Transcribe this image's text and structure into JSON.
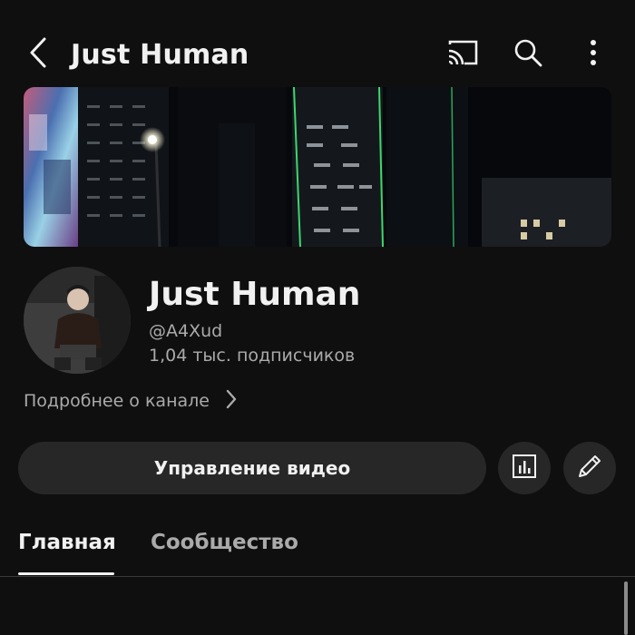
{
  "header": {
    "title": "Just Human",
    "icons": [
      "back-arrow-icon",
      "cast-icon",
      "search-icon",
      "more-vert-icon"
    ]
  },
  "banner": {
    "description_icon": "banner-image"
  },
  "channel": {
    "name": "Just Human",
    "handle": "@A4Xud",
    "subscribers": "1,04 тыс. подписчиков",
    "more_label": "Подробнее о канале"
  },
  "actions": {
    "manage_label": "Управление видео",
    "analytics_icon": "analytics-icon",
    "edit_icon": "pencil-icon"
  },
  "tabs": [
    {
      "label": "Главная",
      "active": true
    },
    {
      "label": "Сообщество",
      "active": false
    }
  ],
  "colors": {
    "background": "#0f0f0f",
    "text_primary": "#f1f1f1",
    "text_secondary": "#aaaaaa",
    "button_bg": "#272727",
    "accent_green": "#3fd66b"
  }
}
